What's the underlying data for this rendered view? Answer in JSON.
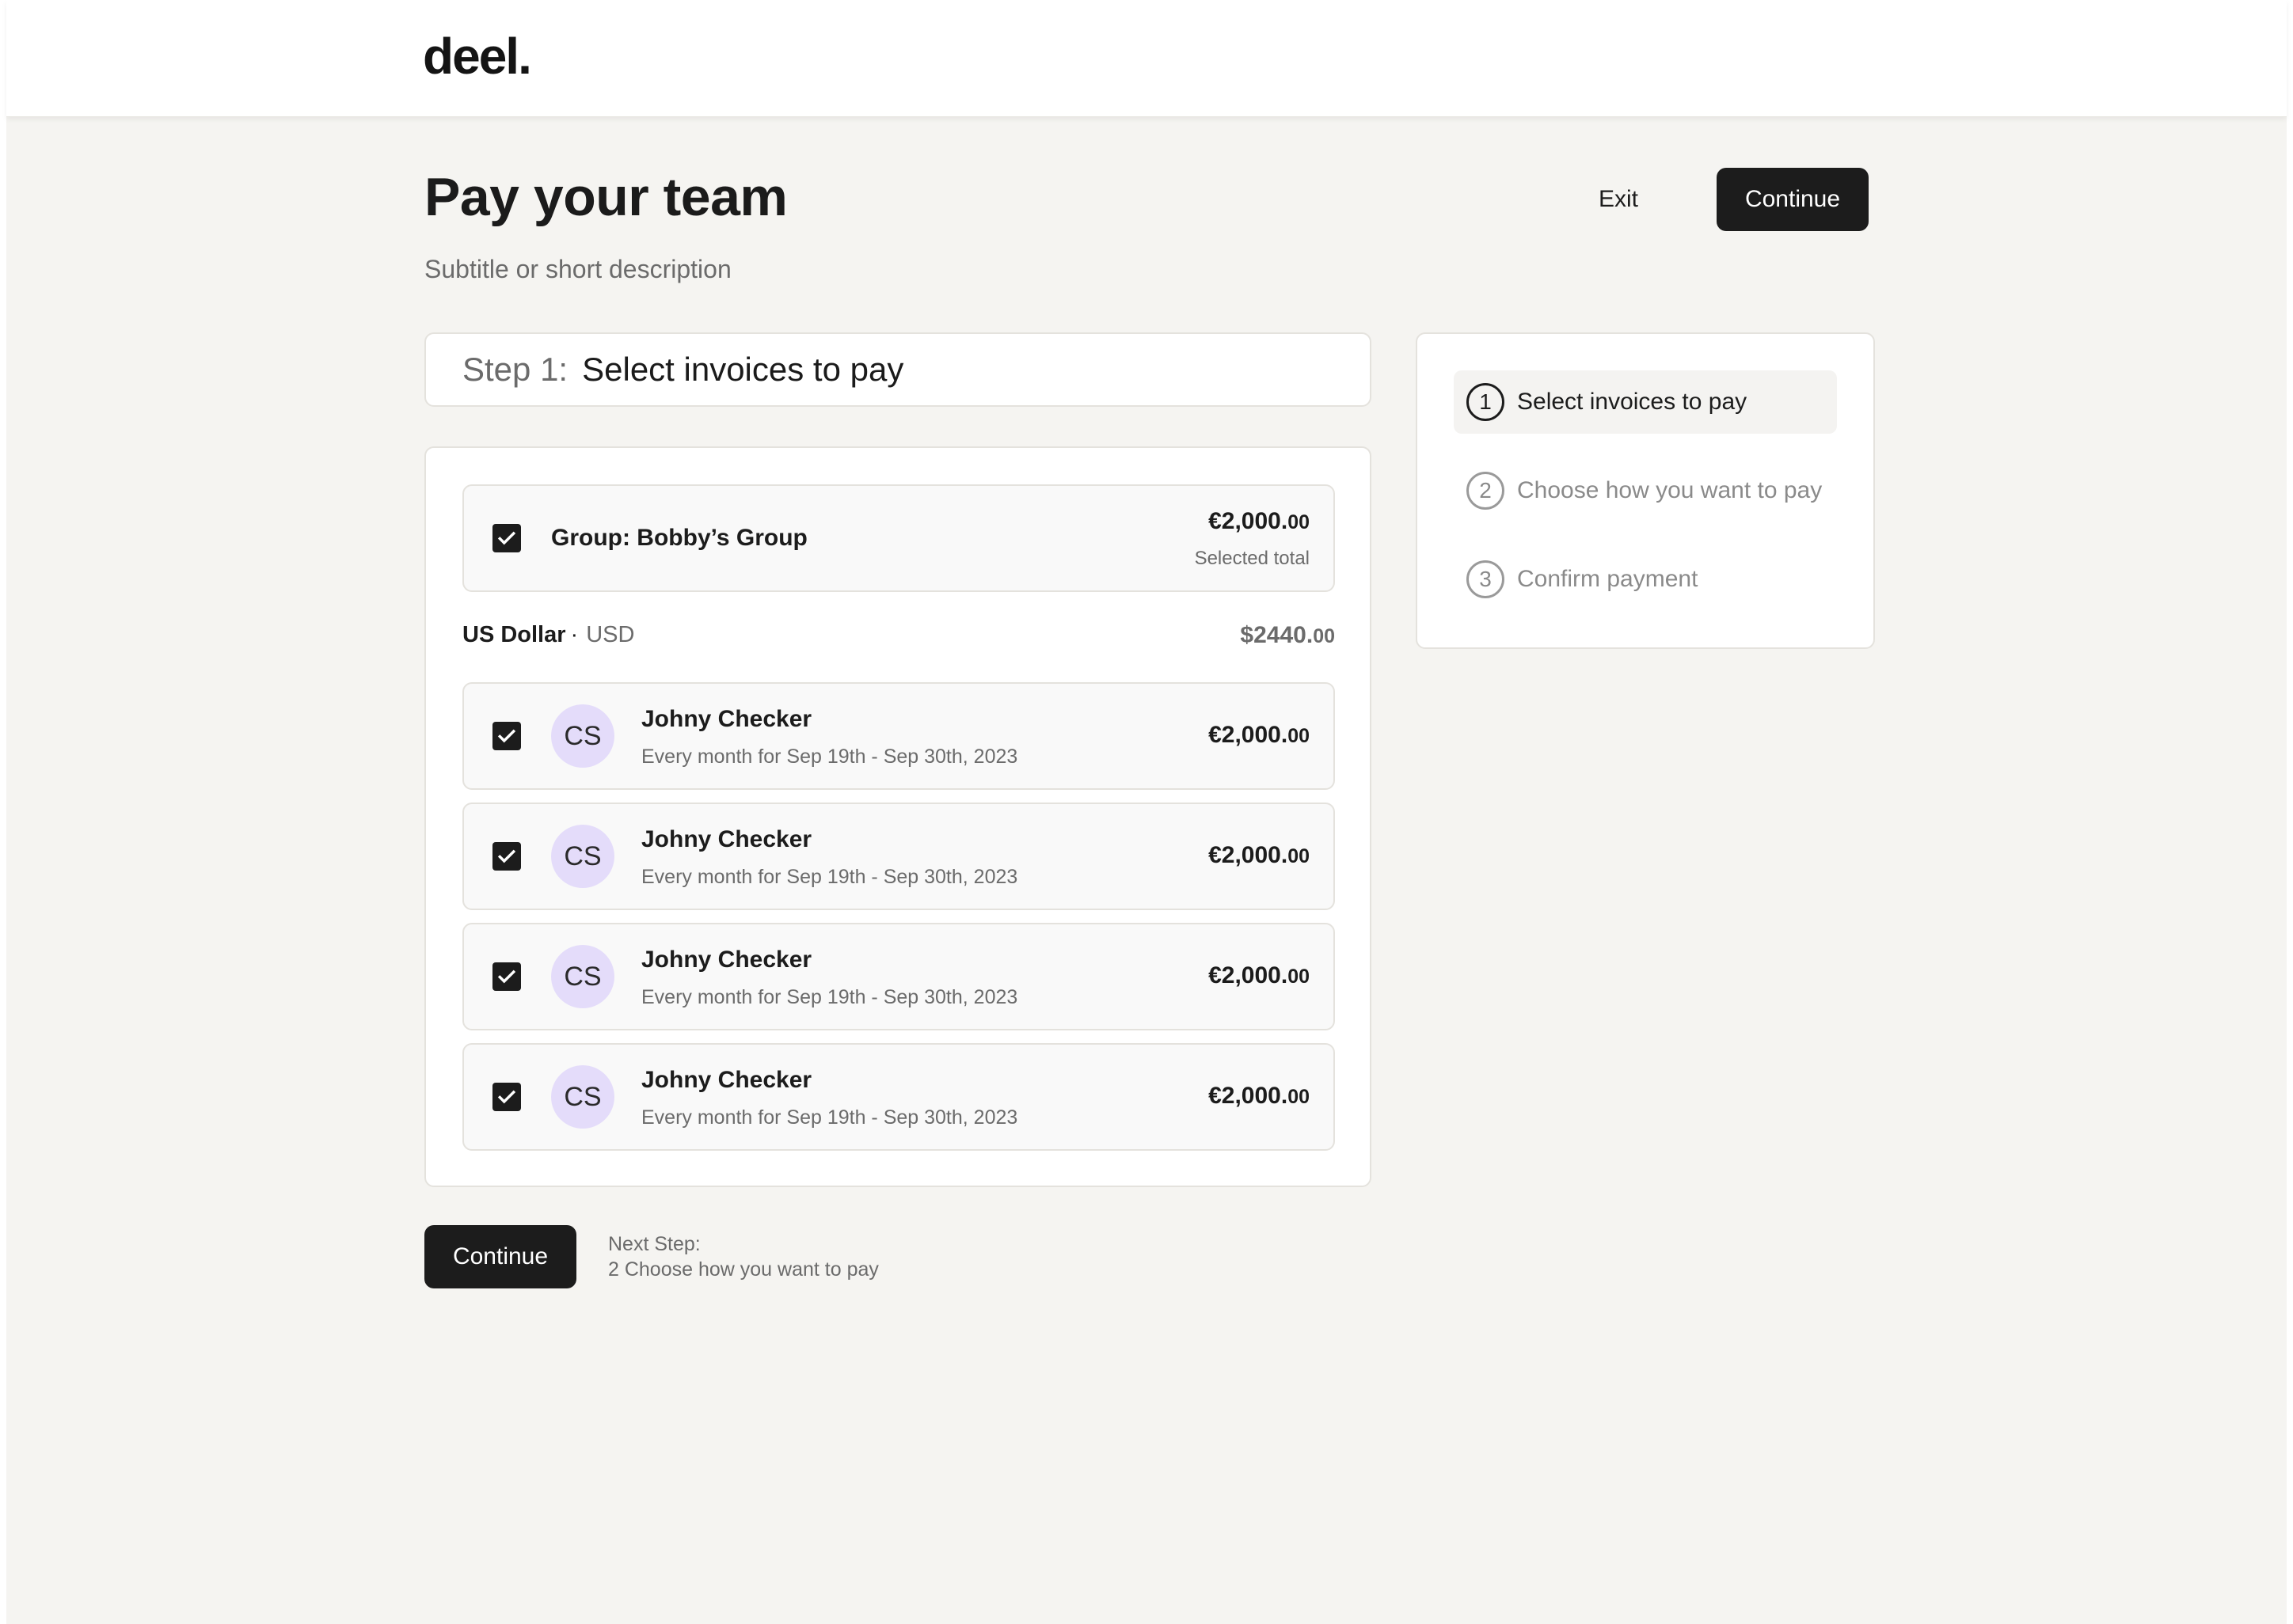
{
  "header": {
    "logo": "deel."
  },
  "page": {
    "title": "Pay your team",
    "subtitle": "Subtitle or short description",
    "exit_label": "Exit",
    "continue_label": "Continue"
  },
  "step": {
    "prefix": "Step 1:",
    "title": "Select invoices to pay"
  },
  "group": {
    "label": "Group: Bobby’s Group",
    "amount_main": "€2,000.",
    "amount_cents": "00",
    "amount_caption": "Selected total",
    "checked": true
  },
  "currency": {
    "name": "US Dollar",
    "separator": "·",
    "code": "USD",
    "total_main": "$2440.",
    "total_cents": "00"
  },
  "invoices": [
    {
      "initials": "CS",
      "name": "Johny Checker",
      "period": "Every month for Sep 19th - Sep 30th, 2023",
      "amount_main": "€2,000.",
      "amount_cents": "00",
      "checked": true
    },
    {
      "initials": "CS",
      "name": "Johny Checker",
      "period": "Every month for Sep 19th - Sep 30th, 2023",
      "amount_main": "€2,000.",
      "amount_cents": "00",
      "checked": true
    },
    {
      "initials": "CS",
      "name": "Johny Checker",
      "period": "Every month for Sep 19th - Sep 30th, 2023",
      "amount_main": "€2,000.",
      "amount_cents": "00",
      "checked": true
    },
    {
      "initials": "CS",
      "name": "Johny Checker",
      "period": "Every month for Sep 19th - Sep 30th, 2023",
      "amount_main": "€2,000.",
      "amount_cents": "00",
      "checked": true
    }
  ],
  "footer": {
    "continue_label": "Continue",
    "next_step_label": "Next Step:",
    "next_step_value": "2 Choose how you want to pay"
  },
  "stepper": {
    "items": [
      {
        "number": "1",
        "label": "Select invoices to pay",
        "active": true
      },
      {
        "number": "2",
        "label": "Choose how you want to pay",
        "active": false
      },
      {
        "number": "3",
        "label": "Confirm payment",
        "active": false
      }
    ]
  },
  "colors": {
    "background": "#f5f4f1",
    "primary_button": "#1c1c1c",
    "avatar": "#e4dcfa",
    "muted_text": "#6b6b6b"
  }
}
